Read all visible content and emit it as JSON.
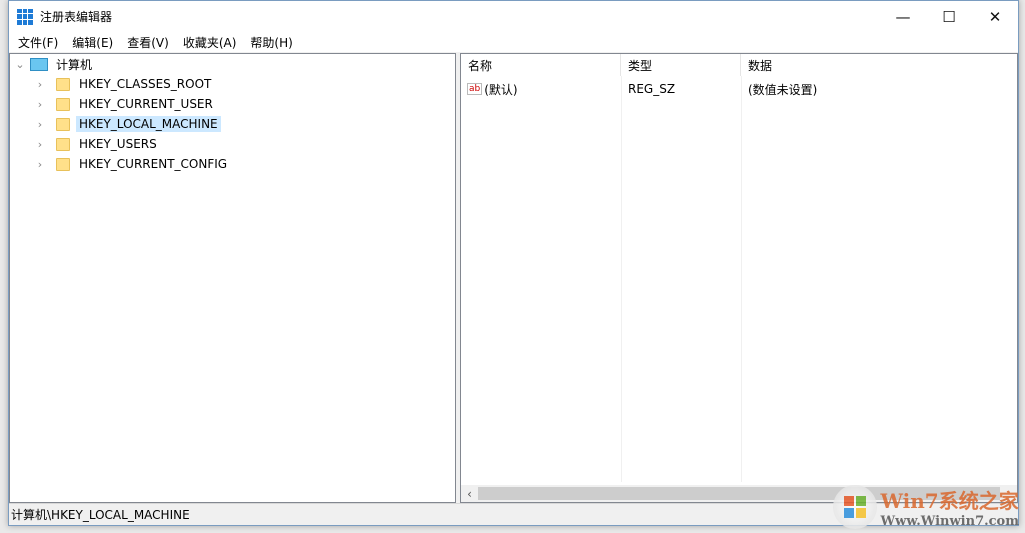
{
  "window": {
    "title": "注册表编辑器"
  },
  "controls": {
    "minimize": "—",
    "maximize": "☐",
    "close": "✕"
  },
  "menu": [
    "文件(F)",
    "编辑(E)",
    "查看(V)",
    "收藏夹(A)",
    "帮助(H)"
  ],
  "tree": {
    "root": "计算机",
    "keys": [
      "HKEY_CLASSES_ROOT",
      "HKEY_CURRENT_USER",
      "HKEY_LOCAL_MACHINE",
      "HKEY_USERS",
      "HKEY_CURRENT_CONFIG"
    ],
    "selected": "HKEY_LOCAL_MACHINE"
  },
  "list": {
    "headers": [
      "名称",
      "类型",
      "数据"
    ],
    "rows": [
      {
        "name": "(默认)",
        "type": "REG_SZ",
        "data": "(数值未设置)",
        "icon": "ab"
      }
    ]
  },
  "status": "计算机\\HKEY_LOCAL_MACHINE",
  "watermark": {
    "line1": "Win7系统之家",
    "line2": "Www.Winwin7.com"
  }
}
